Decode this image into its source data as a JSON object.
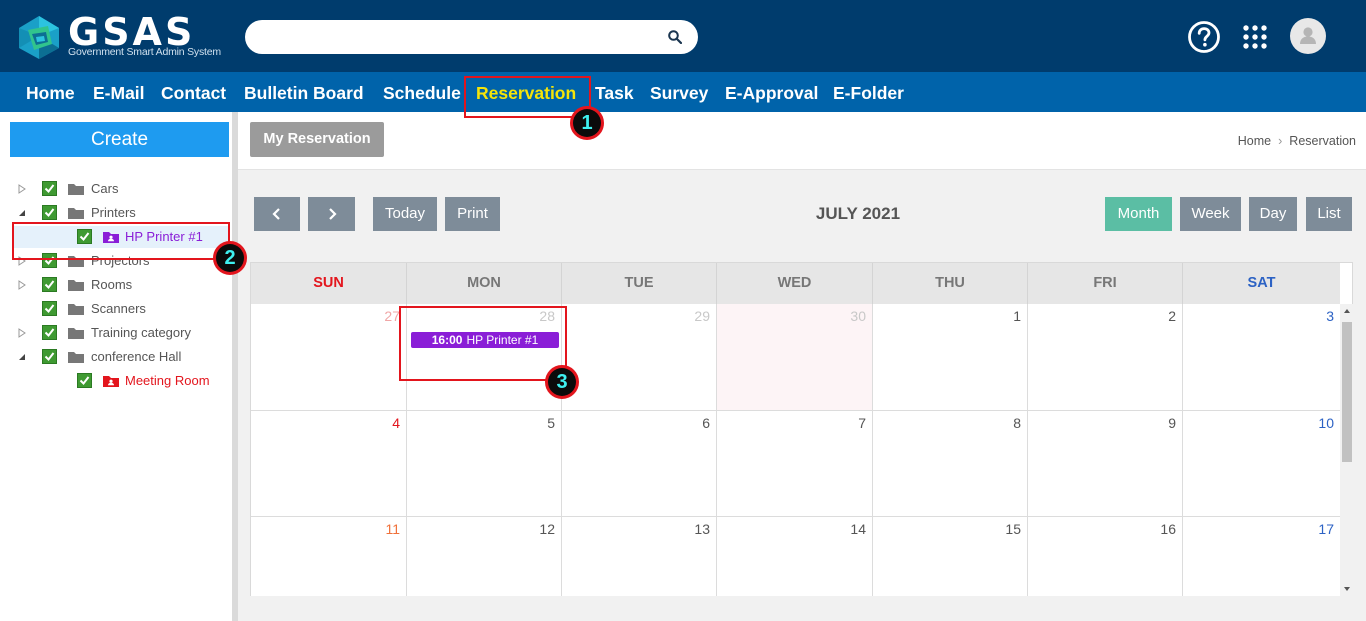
{
  "header": {
    "logo_text": "GSAS",
    "logo_subtitle": "Government Smart Admin System",
    "search_value": "",
    "icons": [
      "search-icon",
      "help-icon",
      "apps-grid-icon",
      "user-avatar-icon"
    ]
  },
  "nav": {
    "items": [
      "Home",
      "E-Mail",
      "Contact",
      "Bulletin Board",
      "Schedule",
      "Reservation",
      "Task",
      "Survey",
      "E-Approval",
      "E-Folder"
    ],
    "active": "Reservation"
  },
  "callouts": [
    "1",
    "2",
    "3"
  ],
  "sidebar": {
    "create_label": "Create",
    "tree": [
      {
        "label": "Cars",
        "expanded": false
      },
      {
        "label": "Printers",
        "expanded": true
      },
      {
        "label": "HP Printer #1",
        "child": true
      },
      {
        "label": "Projectors",
        "expanded": false
      },
      {
        "label": "Rooms",
        "expanded": false
      },
      {
        "label": "Scanners",
        "expanded": false
      },
      {
        "label": "Training category",
        "expanded": false
      },
      {
        "label": "conference Hall",
        "expanded": true
      },
      {
        "label": "Meeting Room",
        "child": true
      }
    ]
  },
  "main": {
    "my_reservation_label": "My Reservation",
    "breadcrumb": [
      "Home",
      "Reservation"
    ],
    "toolbar": {
      "prev_icon": "chevron-left-icon",
      "next_icon": "chevron-right-icon",
      "today": "Today",
      "print": "Print",
      "views": [
        "Month",
        "Week",
        "Day",
        "List"
      ],
      "selected_view": "Month"
    },
    "month_title": "JULY 2021"
  },
  "calendar": {
    "days_of_week": [
      "SUN",
      "MON",
      "TUE",
      "WED",
      "THU",
      "FRI",
      "SAT"
    ],
    "weeks": [
      [
        "27",
        "28",
        "29",
        "30",
        "1",
        "2",
        "3"
      ],
      [
        "4",
        "5",
        "6",
        "7",
        "8",
        "9",
        "10"
      ],
      [
        "11",
        "12",
        "13",
        "14",
        "15",
        "16",
        "17"
      ]
    ],
    "event": {
      "time": "16:00",
      "title": "HP Printer #1"
    }
  },
  "colors": {
    "topbar": "#003c6d",
    "navbar": "#0063aa",
    "active_nav": "#f4e40a",
    "create_button": "#1e9bf0",
    "event": "#8a1ed7",
    "highlight": "#e3151d",
    "selected_view": "#5bbea4"
  }
}
